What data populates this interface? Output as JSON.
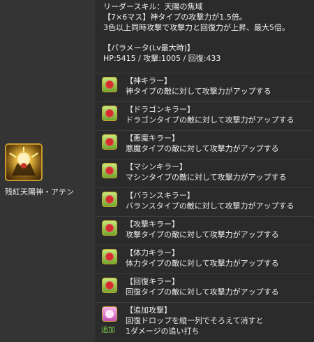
{
  "monster": {
    "name": "残紅天陽神・アテン",
    "icon": "aten-portrait-icon"
  },
  "leader_skill": {
    "line1": "リーダースキル：天陽の焦域",
    "line2": "【7×6マス】神タイプの攻撃力が1.5倍。",
    "line3": "3色以上同時攻撃で攻撃力と回復力が上昇、最大5倍。",
    "params_title": "【パラメータ(Lv最大時)】",
    "params": "HP:5415 / 攻撃:1005 / 回復:433"
  },
  "awakenings": [
    {
      "title": "【神キラー】",
      "desc": "神タイプの敵に対して攻撃力がアップする",
      "icon": "god-killer-icon"
    },
    {
      "title": "【ドラゴンキラー】",
      "desc": "ドラゴンタイプの敵に対して攻撃力がアップする",
      "icon": "dragon-killer-icon"
    },
    {
      "title": "【悪魔キラー】",
      "desc": "悪魔タイプの敵に対して攻撃力がアップする",
      "icon": "devil-killer-icon"
    },
    {
      "title": "【マシンキラー】",
      "desc": "マシンタイプの敵に対して攻撃力がアップする",
      "icon": "machine-killer-icon"
    },
    {
      "title": "【バランスキラー】",
      "desc": "バランスタイプの敵に対して攻撃力がアップする",
      "icon": "balanced-killer-icon"
    },
    {
      "title": "【攻撃キラー】",
      "desc": "攻撃タイプの敵に対して攻撃力がアップする",
      "icon": "attacker-killer-icon"
    },
    {
      "title": "【体力キラー】",
      "desc": "体力タイプの敵に対して攻撃力がアップする",
      "icon": "physical-killer-icon"
    },
    {
      "title": "【回復キラー】",
      "desc": "回復タイプの敵に対して攻撃力がアップする",
      "icon": "healer-killer-icon"
    },
    {
      "title": "【追加攻撃】",
      "desc": "回復ドロップを縦一列でそろえて消すと",
      "desc2": "1ダメージの追い打ち",
      "icon": "additional-attack-icon",
      "sublabel": "追加"
    }
  ]
}
